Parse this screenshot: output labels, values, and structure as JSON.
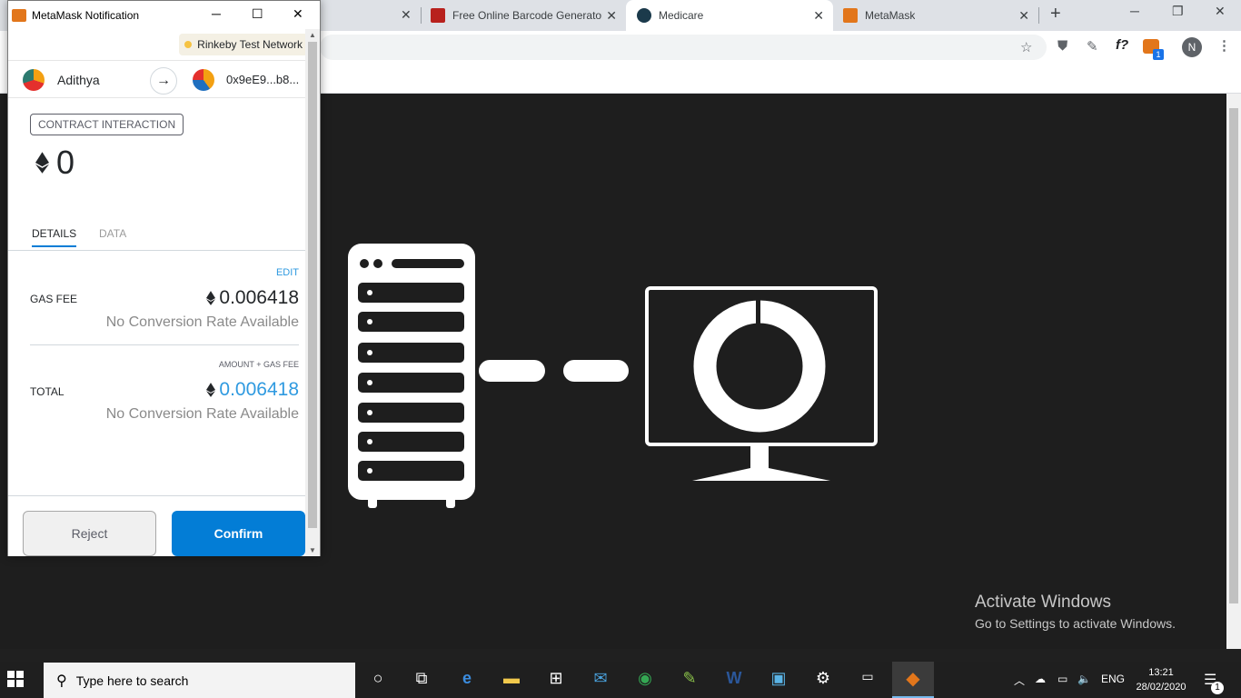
{
  "browser": {
    "tabs": [
      {
        "label": "Free Online Barcode Generator",
        "favicon_color": "#b8211d"
      },
      {
        "label": "Medicare",
        "favicon_color": "#1b3a4b"
      },
      {
        "label": "MetaMask",
        "favicon_color": "#e2761b"
      }
    ],
    "new_tab": "+",
    "toolbar_icons": [
      "star-icon",
      "shield-icon",
      "eyedropper-icon",
      "formula-icon",
      "metamask-extension-icon",
      "profile-avatar",
      "menu-icon"
    ],
    "extension_label": "f?",
    "metamask_badge": "1",
    "profile_initial": "N",
    "activate_title": "Activate Windows",
    "activate_subtitle": "Go to Settings to activate Windows."
  },
  "popup": {
    "title": "MetaMask Notification",
    "network": "Rinkeby Test Network",
    "from_account": "Adithya",
    "to_account": "0x9eE9...b8...",
    "badge": "CONTRACT INTERACTION",
    "amount": "0",
    "tabs": [
      "DETAILS",
      "DATA"
    ],
    "edit": "EDIT",
    "gas_fee_label": "GAS FEE",
    "gas_fee_value": "0.006418",
    "gas_fee_sub": "No Conversion Rate Available",
    "total_header": "AMOUNT + GAS FEE",
    "total_label": "TOTAL",
    "total_value": "0.006418",
    "total_sub": "No Conversion Rate Available",
    "reject": "Reject",
    "confirm": "Confirm",
    "colors": {
      "accent": "#037dd6",
      "link": "#2f9ae0"
    }
  },
  "taskbar": {
    "search_placeholder": "Type here to search",
    "apps": [
      "cortana-icon",
      "task-view-icon",
      "edge-icon",
      "file-explorer-icon",
      "store-icon",
      "mail-icon",
      "chrome-icon",
      "notepad-plus-icon",
      "word-icon",
      "control-panel-icon",
      "settings-icon",
      "terminal-icon",
      "metamask-taskbar-icon"
    ],
    "language": "ENG",
    "time": "13:21",
    "date": "28/02/2020",
    "notification_count": "1"
  }
}
